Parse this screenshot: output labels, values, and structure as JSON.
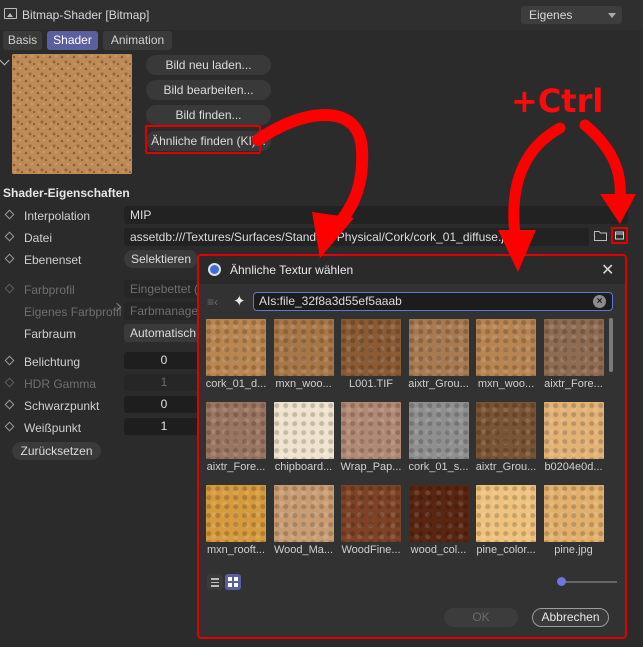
{
  "header": {
    "title": "Bitmap-Shader [Bitmap]",
    "preset": "Eigenes"
  },
  "tabs": [
    {
      "label": "Basis",
      "active": false
    },
    {
      "label": "Shader",
      "active": true
    },
    {
      "label": "Animation",
      "active": false
    }
  ],
  "preview_buttons": {
    "reload": "Bild neu laden...",
    "edit": "Bild bearbeiten...",
    "find": "Bild finden...",
    "similar": "Ähnliche finden (KI)..."
  },
  "shader_props": {
    "section": "Shader-Eigenschaften",
    "interpolation_label": "Interpolation",
    "interpolation_value": "MIP",
    "file_label": "Datei",
    "file_value": "assetdb:///Textures/Surfaces/Standard Physical/Cork/cork_01_diffuse.jpg",
    "layerset_label": "Ebenenset",
    "layerset_button": "Selektieren",
    "colorprofile_label": "Farbprofil",
    "colorprofile_value": "Eingebettet (",
    "own_colorprofile_label": "Eigenes Farbprofil",
    "own_colorprofile_value": "Farbmanagem",
    "colorspace_label": "Farbraum",
    "colorspace_value": "Automatisch",
    "exposure_label": "Belichtung",
    "exposure_value": "0",
    "hdr_gamma_label": "HDR Gamma",
    "hdr_gamma_value": "1",
    "blackpoint_label": "Schwarzpunkt",
    "blackpoint_value": "0",
    "whitepoint_label": "Weißpunkt",
    "whitepoint_value": "1",
    "reset_button": "Zurücksetzen"
  },
  "dialog": {
    "title": "Ähnliche Textur wählen",
    "search_value": "AIs:file_32f8a3d55ef5aaab",
    "ok": "OK",
    "cancel": "Abbrechen",
    "textures": [
      {
        "label": "cork_01_d...",
        "color": "#b98550"
      },
      {
        "label": "mxn_woo...",
        "color": "#a87748"
      },
      {
        "label": "L001.TIF",
        "color": "#8a5b35"
      },
      {
        "label": "aixtr_Grou...",
        "color": "#a77a52"
      },
      {
        "label": "mxn_woo...",
        "color": "#b78452"
      },
      {
        "label": "aixtr_Fore...",
        "color": "#8f6b52"
      },
      {
        "label": "aixtr_Fore...",
        "color": "#9a7561"
      },
      {
        "label": "chipboard...",
        "color": "#efe3cd"
      },
      {
        "label": "Wrap_Pap...",
        "color": "#b28974"
      },
      {
        "label": "cork_01_s...",
        "color": "#8f8f8f"
      },
      {
        "label": "aixtr_Grou...",
        "color": "#7a5433"
      },
      {
        "label": "b0204e0d...",
        "color": "#e3b276"
      },
      {
        "label": "mxn_rooft...",
        "color": "#d69a3f"
      },
      {
        "label": "Wood_Ma...",
        "color": "#c99d73"
      },
      {
        "label": "WoodFine...",
        "color": "#7e4326"
      },
      {
        "label": "wood_col...",
        "color": "#5a2612"
      },
      {
        "label": "pine_color...",
        "color": "#efc27d"
      },
      {
        "label": "pine.jpg",
        "color": "#e2b06c"
      }
    ]
  },
  "annotation": {
    "shortcut": "+Ctrl",
    "color": "#ff0000"
  }
}
